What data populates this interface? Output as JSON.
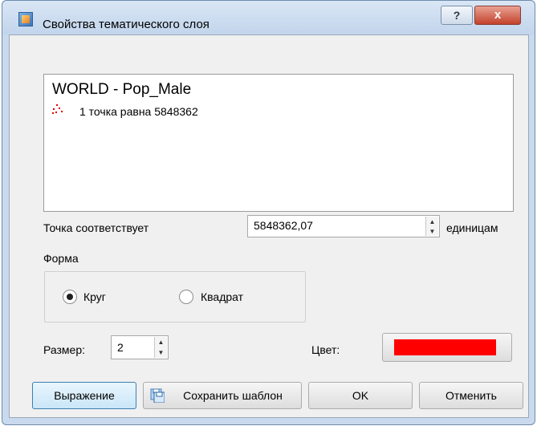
{
  "window": {
    "title": "Свойства тематического слоя"
  },
  "titlebar": {
    "help_label": "?",
    "close_label": "x"
  },
  "preview": {
    "layer_name": "WORLD - Pop_Male",
    "legend_text": "1 точка равна 5848362"
  },
  "dot_value": {
    "label": "Точка соответствует",
    "value": "5848362,07",
    "units": "единицам"
  },
  "shape": {
    "label": "Форма",
    "options": [
      {
        "label": "Круг",
        "selected": true
      },
      {
        "label": "Квадрат",
        "selected": false
      }
    ]
  },
  "size": {
    "label": "Размер:",
    "value": "2"
  },
  "color": {
    "label": "Цвет:",
    "value": "#ff0000"
  },
  "buttons": {
    "expression": "Выражение",
    "save_template": "Сохранить шаблон",
    "ok": "OK",
    "cancel": "Отменить"
  }
}
